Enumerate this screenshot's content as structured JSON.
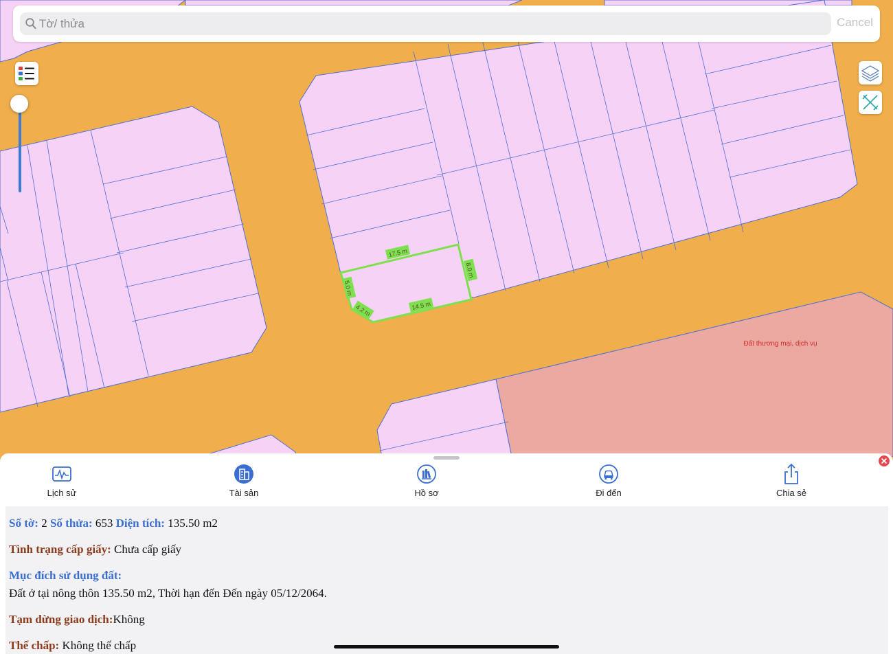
{
  "search": {
    "placeholder": "Tờ/ thửa",
    "cancel_label": "Cancel"
  },
  "map": {
    "zone_label": "Đất thương mại, dịch vụ",
    "measurements": {
      "top": "17.5 m",
      "right": "8.0 m",
      "bottom": "14.5 m",
      "left": "5.0 m",
      "corner": "4.2 m"
    },
    "colors": {
      "road": "#f0ae4c",
      "residential": "#f6d2f7",
      "commercial": "#eca9a2",
      "boundary": "#4e6fd6",
      "selected": "#7ee04e",
      "label_red": "#d42b2b"
    }
  },
  "controls": {
    "zoom_level": 0.0
  },
  "actions": [
    {
      "label": "Lịch sử",
      "icon": "history-icon"
    },
    {
      "label": "Tài sản",
      "icon": "building-icon"
    },
    {
      "label": "Hồ sơ",
      "icon": "records-icon"
    },
    {
      "label": "Đi đến",
      "icon": "car-icon"
    },
    {
      "label": "Chia sẻ",
      "icon": "share-icon"
    }
  ],
  "parcel": {
    "sheet_label": "Số tờ:",
    "sheet_value": "2",
    "plot_label": "Số thửa:",
    "plot_value": "653",
    "area_label": "Diện tích:",
    "area_value": "135.50 m2",
    "cert_label": "Tình trạng cấp giấy:",
    "cert_value": "Chưa cấp giấy",
    "purpose_label": "Mục đích sử dụng đất:",
    "purpose_value": "Đất ở tại nông thôn 135.50 m2, Thời hạn đến Đến ngày 05/12/2064.",
    "suspend_label": "Tạm dừng giao dịch:",
    "suspend_value": "Không",
    "mortgage_label": "Thế chấp:",
    "mortgage_value": "Không thế chấp"
  }
}
